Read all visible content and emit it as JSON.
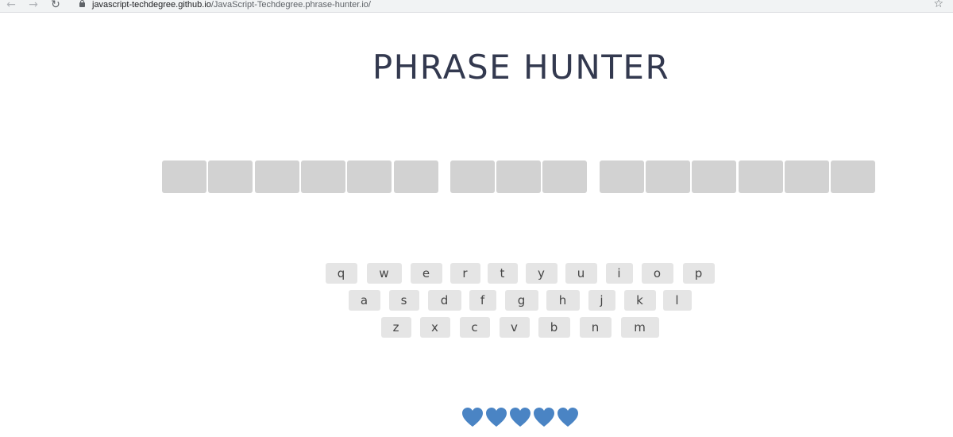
{
  "browser": {
    "back_icon": "arrow-left-icon",
    "forward_icon": "arrow-right-icon",
    "reload_icon": "reload-icon",
    "lock_icon": "lock-icon",
    "url_host": "javascript-techdegree.github.io",
    "url_path": "/JavaScript-Techdegree.phrase-hunter.io/",
    "bookmark_icon": "star-icon"
  },
  "title": "PHRASE HUNTER",
  "phrase": {
    "words": [
      6,
      3,
      6
    ],
    "letter_color": "#d2d2d2"
  },
  "keyboard": {
    "rows": [
      [
        "q",
        "w",
        "e",
        "r",
        "t",
        "y",
        "u",
        "i",
        "o",
        "p"
      ],
      [
        "a",
        "s",
        "d",
        "f",
        "g",
        "h",
        "j",
        "k",
        "l"
      ],
      [
        "z",
        "x",
        "c",
        "v",
        "b",
        "n",
        "m"
      ]
    ],
    "key_color": "#e5e5e5"
  },
  "scoreboard": {
    "lives": 5,
    "heart_icon": "heart-icon",
    "heart_color": "#4a84c4"
  }
}
